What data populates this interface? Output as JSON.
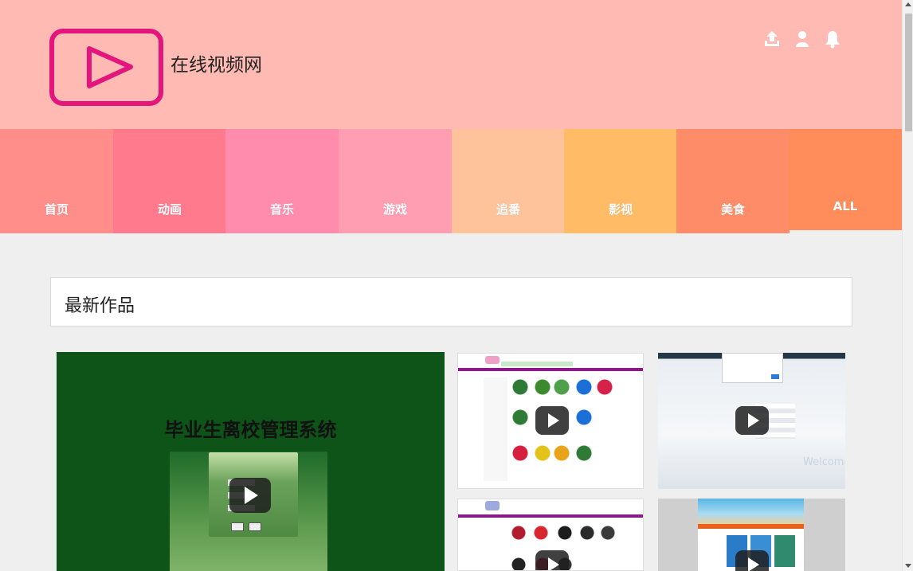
{
  "header": {
    "site_name": "在线视频网",
    "logo_icon": "play-logo-icon",
    "icons": [
      "upload-icon",
      "user-icon",
      "bell-icon"
    ],
    "background": "#ffbbb3"
  },
  "nav": {
    "items": [
      {
        "label": "首页",
        "color": "#ff8e8b"
      },
      {
        "label": "动画",
        "color": "#ff7a8c"
      },
      {
        "label": "音乐",
        "color": "#ff8cad"
      },
      {
        "label": "游戏",
        "color": "#ff9db3"
      },
      {
        "label": "追番",
        "color": "#ffc39b"
      },
      {
        "label": "影视",
        "color": "#ffbb66"
      },
      {
        "label": "美食",
        "color": "#ff8c69"
      },
      {
        "label": "ALL",
        "color": "#ff8c5a"
      }
    ]
  },
  "section": {
    "title": "最新作品"
  },
  "works": {
    "featured_title": "毕业生离校管理系统",
    "thumb2_welcome": "Welcome"
  }
}
